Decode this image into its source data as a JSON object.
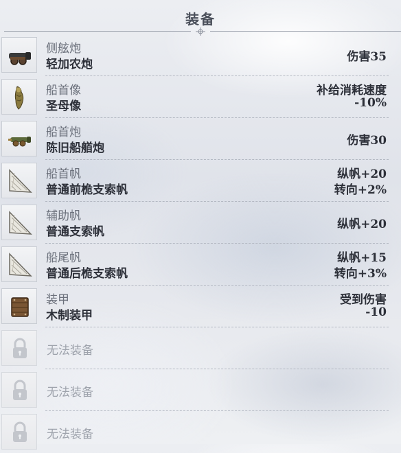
{
  "header": {
    "title": "装备"
  },
  "slots": [
    {
      "slot": "侧舷炮",
      "item": "轻加农炮",
      "stats": [
        "伤害35"
      ],
      "icon": "cannon-icon"
    },
    {
      "slot": "船首像",
      "item": "圣母像",
      "stats": [
        "补给消耗速度",
        "-10%"
      ],
      "icon": "figurehead-icon"
    },
    {
      "slot": "船首炮",
      "item": "陈旧船艏炮",
      "stats": [
        "伤害30"
      ],
      "icon": "bow-cannon-icon"
    },
    {
      "slot": "船首帆",
      "item": "普通前桅支索帆",
      "stats": [
        "纵帆+20",
        "转向+2%"
      ],
      "icon": "sail-icon"
    },
    {
      "slot": "辅助帆",
      "item": "普通支索帆",
      "stats": [
        "纵帆+20"
      ],
      "icon": "sail-icon"
    },
    {
      "slot": "船尾帆",
      "item": "普通后桅支索帆",
      "stats": [
        "纵帆+15",
        "转向+3%"
      ],
      "icon": "sail-icon"
    },
    {
      "slot": "装甲",
      "item": "木制装甲",
      "stats": [
        "受到伤害",
        "-10"
      ],
      "icon": "armor-icon"
    }
  ],
  "locked_slots": [
    {
      "text": "无法装备",
      "icon": "lock-icon"
    },
    {
      "text": "无法装备",
      "icon": "lock-icon"
    },
    {
      "text": "无法装备",
      "icon": "lock-icon"
    }
  ]
}
